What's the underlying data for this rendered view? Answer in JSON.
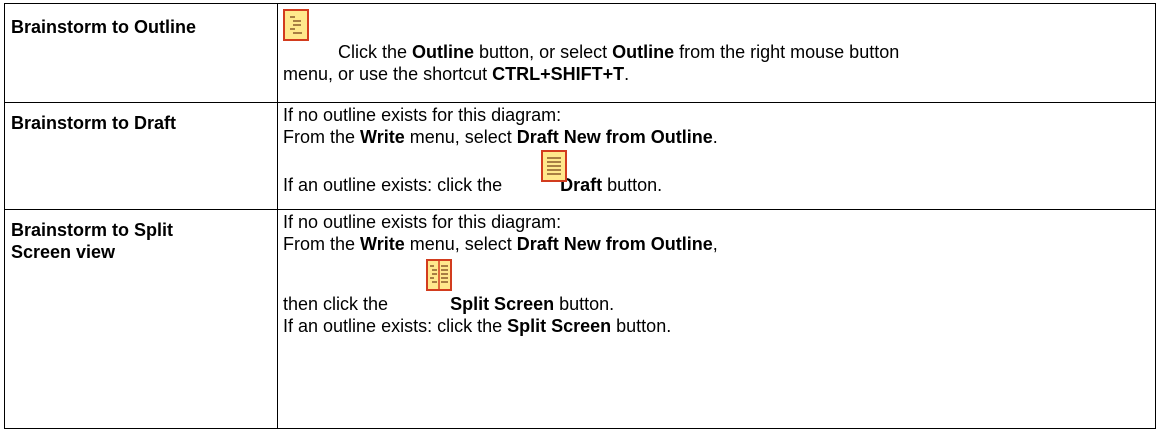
{
  "rows": [
    {
      "label": "Brainstorm to Outline",
      "icon": "outline-icon",
      "desc": {
        "t1": "Click the ",
        "b1": "Outline",
        "t2": " button, or select ",
        "b2": "Outline",
        "t3": " from the right mouse button",
        "t4": "menu, or use the shortcut ",
        "b3": "CTRL+SHIFT+T",
        "t5": "."
      }
    },
    {
      "label": "Brainstorm to Draft",
      "icon": "draft-icon",
      "desc": {
        "line1": "If no outline exists for this diagram:",
        "t1": "From the ",
        "b1": "Write",
        "t2": " menu, select ",
        "b2": "Draft New from Outline",
        "t3": ".",
        "t4": "If an outline exists: click the",
        "b3": "Draft",
        "t5": " button."
      }
    },
    {
      "label_line1": "Brainstorm to Split",
      "label_line2": "Screen view",
      "icon": "split-screen-icon",
      "desc": {
        "line1": "If no outline exists for this diagram:",
        "t1": "From the ",
        "b1": "Write",
        "t2": " menu, select ",
        "b2": "Draft New from Outline",
        "t3": ",",
        "t4": "then click the",
        "b3": "Split Screen",
        "t5": " button.",
        "t6": "If an outline exists: click the ",
        "b4": "Split Screen",
        "t7": " button."
      }
    }
  ],
  "colors": {
    "icon_fill": "#FFE88C",
    "icon_border": "#D23C1E",
    "icon_lines": "#8B5A2B"
  }
}
